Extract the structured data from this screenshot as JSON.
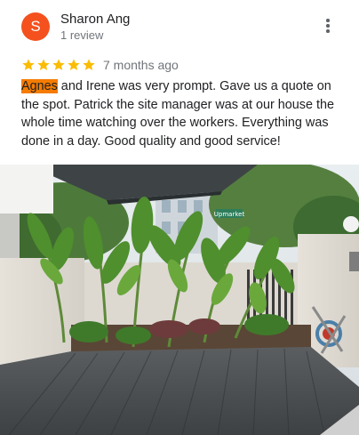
{
  "reviewer": {
    "initial": "S",
    "name": "Sharon Ang",
    "review_count": "1 review",
    "avatar_color": "#f4511e"
  },
  "rating": {
    "stars": 5,
    "max": 5,
    "star_color": "#fbbc04",
    "date": "7 months ago"
  },
  "review": {
    "highlight": "Agnes",
    "highlight_color": "#f57c00",
    "text": " and Irene was very prompt. Gave us a quote on the spot. Patrick the site manager was at our house the whole time watching over the workers. Everything was done in a day. Good quality and good service!"
  },
  "photo": {
    "street_sign": "Upmarket"
  },
  "icons": {
    "menu": "more-vert-icon",
    "star": "star-icon"
  }
}
